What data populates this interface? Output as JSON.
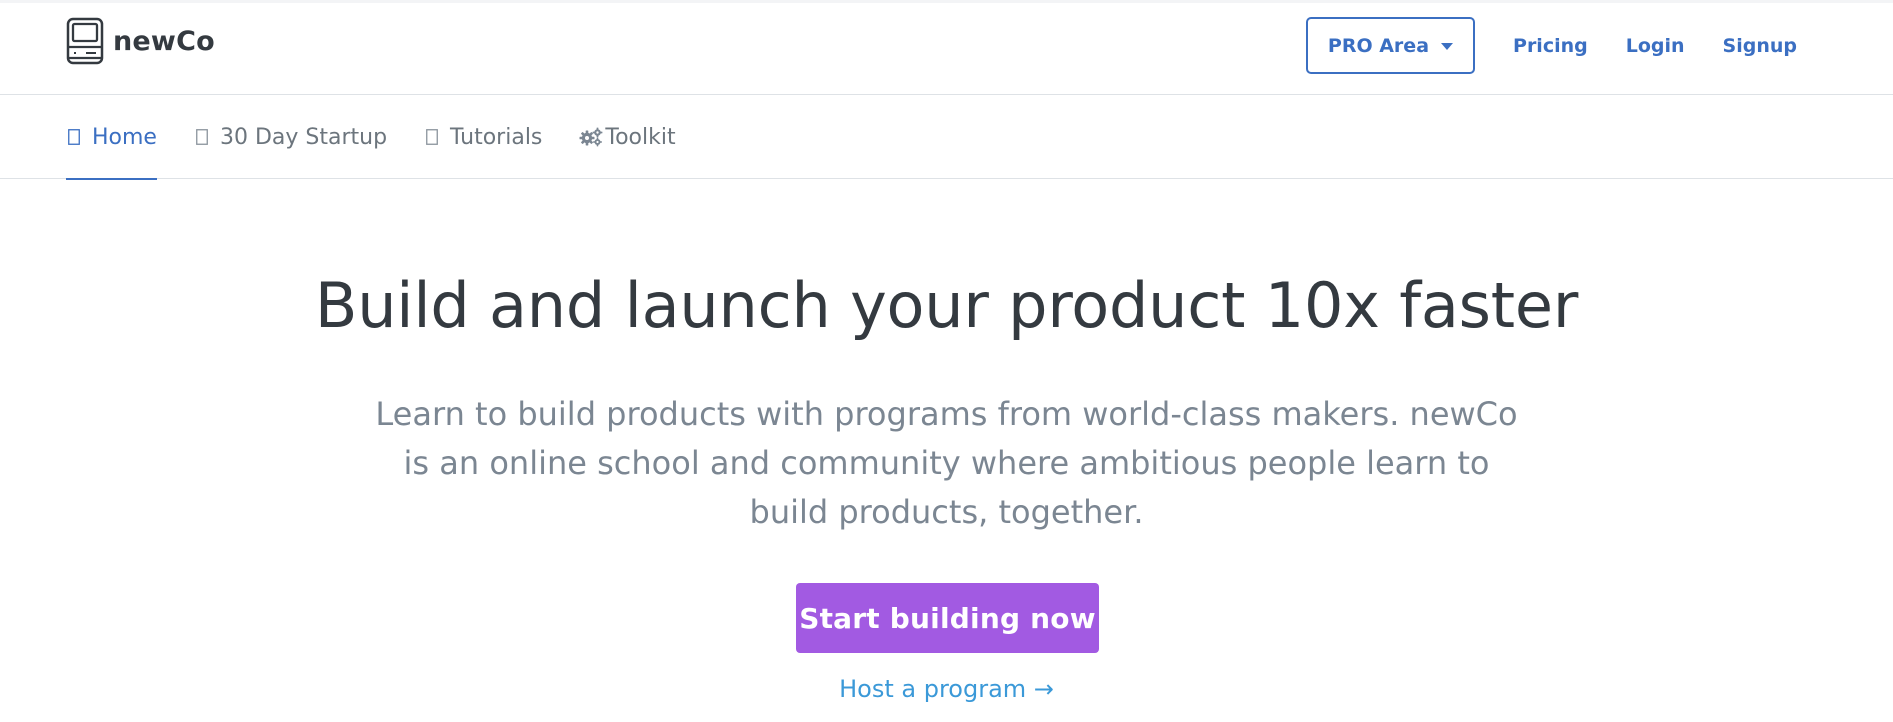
{
  "brand": {
    "name": "newCo",
    "logo_icon": "monitor-logo-icon"
  },
  "topnav": {
    "pro_area_label": "PRO Area",
    "pro_area_icon": "caret-down-icon",
    "links": [
      {
        "label": "Pricing"
      },
      {
        "label": "Login"
      },
      {
        "label": "Signup"
      }
    ]
  },
  "subnav": {
    "items": [
      {
        "label": "Home",
        "icon": "home-icon",
        "active": true
      },
      {
        "label": "30 Day Startup",
        "icon": "calendar-icon",
        "active": false
      },
      {
        "label": "Tutorials",
        "icon": "book-icon",
        "active": false
      },
      {
        "label": "Toolkit",
        "icon": "gears-icon",
        "active": false
      }
    ]
  },
  "hero": {
    "title": "Build and launch your product 10x faster",
    "subtitle": "Learn to build products with programs from world-class makers. newCo is an online school and community where ambitious people learn to build products, together.",
    "cta_label": "Start building now",
    "host_link": "Host a program →"
  },
  "colors": {
    "link_blue": "#3b6fc2",
    "cta_purple": "#a25ae2",
    "host_link_blue": "#3b99d8",
    "muted_gray": "#6c757d"
  }
}
